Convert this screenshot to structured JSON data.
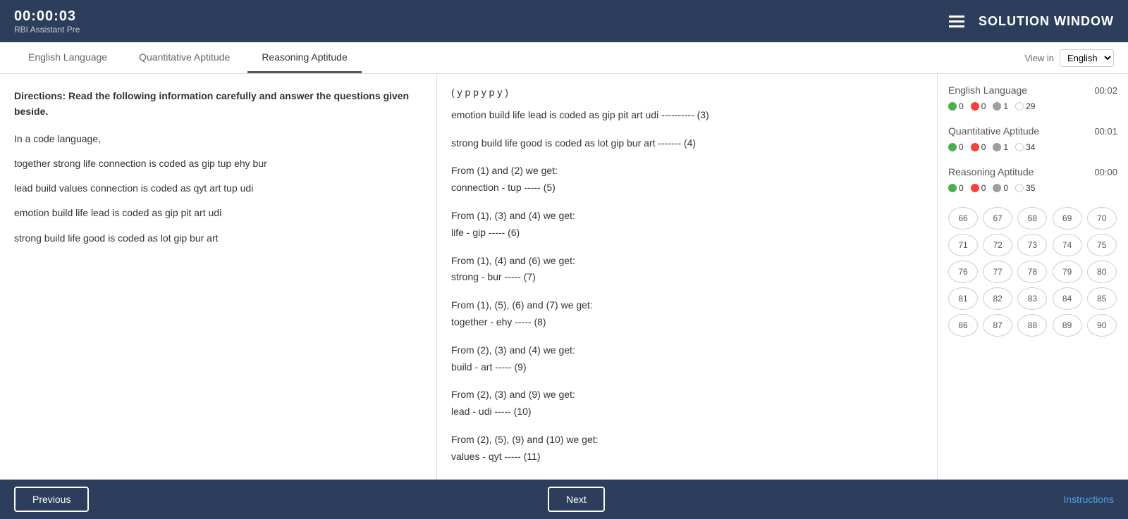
{
  "header": {
    "timer": "00:00:03",
    "subtitle": "RBI Assistant Pre",
    "solution_title": "SOLUTION WINDOW"
  },
  "tabs": [
    {
      "label": "English Language",
      "active": false
    },
    {
      "label": "Quantitative Aptitude",
      "active": false
    },
    {
      "label": "Reasoning Aptitude",
      "active": true
    }
  ],
  "view_in": {
    "label": "View in",
    "value": "English"
  },
  "left_panel": {
    "directions": "Directions: Read the following information carefully and answer the questions given beside.",
    "intro": "In a code language,",
    "lines": [
      "together strong life connection is coded as gip tup ehy bur",
      "lead build values connection is coded as qyt art tup udi",
      "emotion build life lead is coded as gip pit art udi",
      "strong build life good is coded as lot gip bur art"
    ]
  },
  "middle_panel": {
    "line_top": "( y p p y p y )",
    "solutions": [
      {
        "text": "emotion build life lead is coded as gip pit art udi ---------- (3)"
      },
      {
        "text": "strong build life good is coded as lot gip bur art ------- (4)"
      },
      {
        "text": "From (1) and (2) we get:\nconnection - tup ----- (5)"
      },
      {
        "text": "From (1), (3) and (4) we get:\nlife - gip ----- (6)"
      },
      {
        "text": "From (1), (4) and (6) we get:\nstrong - bur ----- (7)"
      },
      {
        "text": "From (1), (5), (6) and (7) we get:\ntogether - ehy ----- (8)"
      },
      {
        "text": "From (2), (3) and (4) we get:\nbuild - art ----- (9)"
      },
      {
        "text": "From (2), (3) and (9) we get:\nlead - udi ----- (10)"
      },
      {
        "text": "From (2), (5), (9) and (10) we get:\nvalues - qyt ----- (11)"
      }
    ]
  },
  "right_panel": {
    "sections": [
      {
        "name": "English Language",
        "time": "00:02",
        "stats": [
          {
            "type": "green",
            "count": "0"
          },
          {
            "type": "red",
            "count": "0"
          },
          {
            "type": "gray",
            "count": "1"
          },
          {
            "type": "white",
            "count": "29"
          }
        ]
      },
      {
        "name": "Quantitative Aptitude",
        "time": "00:01",
        "stats": [
          {
            "type": "green",
            "count": "0"
          },
          {
            "type": "red",
            "count": "0"
          },
          {
            "type": "gray",
            "count": "1"
          },
          {
            "type": "white",
            "count": "34"
          }
        ]
      },
      {
        "name": "Reasoning Aptitude",
        "time": "00:00",
        "stats": [
          {
            "type": "green",
            "count": "0"
          },
          {
            "type": "red",
            "count": "0"
          },
          {
            "type": "gray",
            "count": "0"
          },
          {
            "type": "white",
            "count": "35"
          }
        ]
      }
    ],
    "question_numbers": [
      66,
      67,
      68,
      69,
      70,
      71,
      72,
      73,
      74,
      75,
      76,
      77,
      78,
      79,
      80,
      81,
      82,
      83,
      84,
      85,
      86,
      87,
      88,
      89,
      90
    ]
  },
  "footer": {
    "prev_label": "Previous",
    "next_label": "Next",
    "instructions_label": "Instructions"
  }
}
